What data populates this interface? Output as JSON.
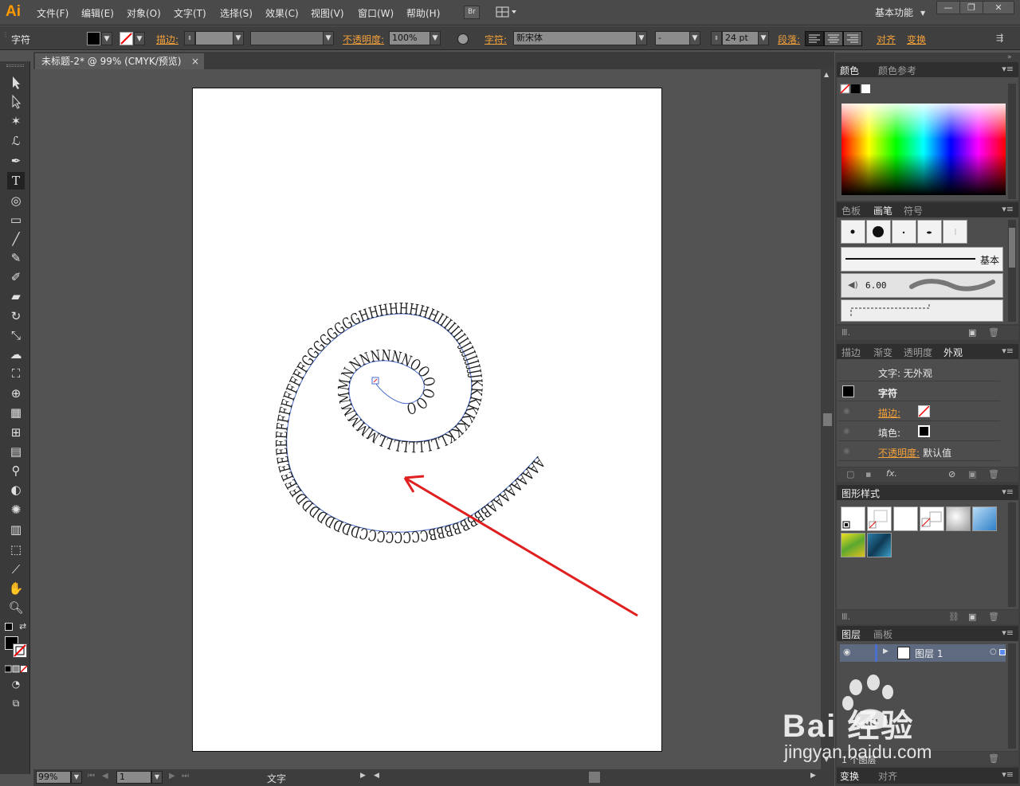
{
  "app": {
    "logo": "Ai"
  },
  "menu": [
    "文件(F)",
    "编辑(E)",
    "对象(O)",
    "文字(T)",
    "选择(S)",
    "效果(C)",
    "视图(V)",
    "窗口(W)",
    "帮助(H)"
  ],
  "bridge_button": "Br",
  "workspace": "基本功能",
  "control_bar": {
    "tool_name": "字符",
    "stroke_label": "描边:",
    "opacity_label": "不透明度:",
    "opacity_value": "100%",
    "character_label": "字符:",
    "font_name": "新宋体",
    "font_style": "-",
    "font_size": "24 pt",
    "paragraph_label": "段落:",
    "align_label": "对齐",
    "transform_label": "变换"
  },
  "document_tab": {
    "title": "未标题-2* @ 99% (CMYK/预览)",
    "close": "×"
  },
  "spiral_text": "AAAAAAAAABBBBBBBBCCCCCCCCDDDDDDDDEEEEEEEEFFFFFFFFFGGGGGGGGHHHHHHHHIIIIIIIIJJJJJJJJKKKKKKKKLLLLLLLLLMMMMMMNNNNNNNOOOOOO",
  "status": {
    "zoom": "99%",
    "page": "1",
    "tool": "文字"
  },
  "panels": {
    "color": {
      "tabs": [
        "颜色",
        "颜色参考"
      ]
    },
    "brushes": {
      "tabs": [
        "色板",
        "画笔",
        "符号"
      ],
      "basic_label": "基本",
      "brush_size": "6.00"
    },
    "appearance": {
      "tabs": [
        "描边",
        "渐变",
        "透明度",
        "外观"
      ],
      "text_row": "文字: 无外观",
      "char_row": "字符",
      "stroke_row": "描边:",
      "fill_row": "填色:",
      "opacity_row": "不透明度:",
      "opacity_value": "默认值"
    },
    "graphic_styles": {
      "tabs": [
        "图形样式"
      ]
    },
    "layers": {
      "tabs": [
        "图层",
        "画板"
      ],
      "layer_name": "图层 1",
      "footer": "1 个图层"
    },
    "bottom": {
      "tabs": [
        "变换",
        "对齐"
      ]
    }
  },
  "watermark": {
    "brand": "Bai 经验",
    "url": "jingyan.baidu.com"
  },
  "colors": {
    "accent": "#ff9a00",
    "arrow": "#e02020",
    "path": "#4a6fcf"
  }
}
